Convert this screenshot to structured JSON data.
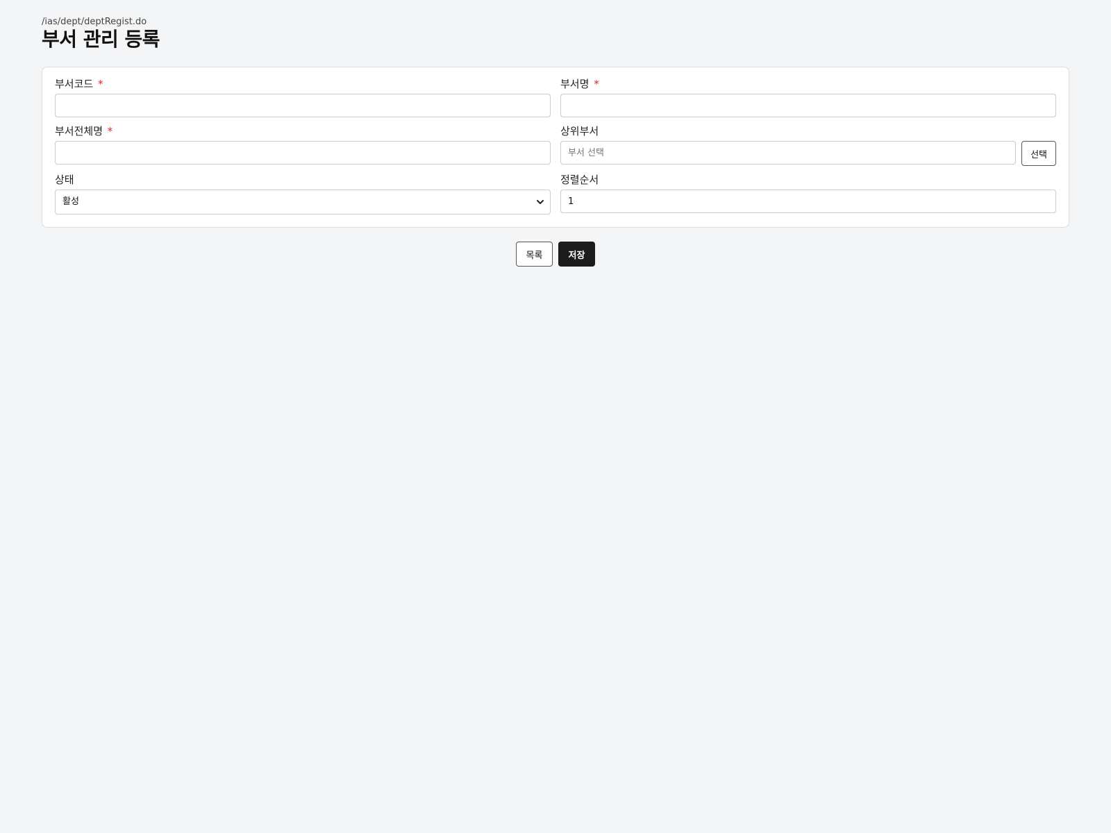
{
  "header": {
    "path": "/ias/dept/deptRegist.do",
    "title": "부서 관리 등록"
  },
  "form": {
    "dept_code": {
      "label": "부서코드",
      "required_mark": "*",
      "value": ""
    },
    "dept_name": {
      "label": "부서명",
      "required_mark": "*",
      "value": ""
    },
    "dept_full_name": {
      "label": "부서전체명",
      "required_mark": "*",
      "value": ""
    },
    "parent_dept": {
      "label": "상위부서",
      "placeholder": "부서 선택",
      "value": "",
      "select_button": "선택"
    },
    "status": {
      "label": "상태",
      "selected": "활성"
    },
    "sort_order": {
      "label": "정렬순서",
      "value": "1"
    }
  },
  "actions": {
    "list_label": "목록",
    "save_label": "저장"
  },
  "colors": {
    "required": "#d62828",
    "primary_button": "#1c1c1c",
    "background": "#f4f5f7"
  }
}
